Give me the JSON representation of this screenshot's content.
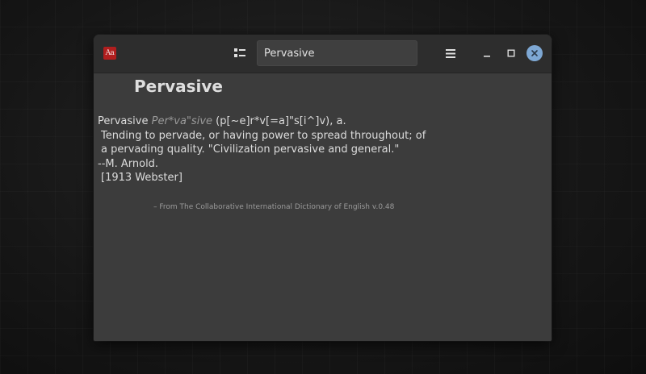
{
  "app": {
    "icon": "dictionary-app-icon",
    "icon_text": "Aa"
  },
  "header": {
    "view_icon": "view-toggle-icon",
    "search": {
      "value": "Pervasive",
      "placeholder": ""
    },
    "menu_icon": "hamburger-menu-icon",
    "minimize_icon": "minimize-icon",
    "maximize_icon": "maximize-icon",
    "close_icon": "close-icon"
  },
  "entry": {
    "headword": "Pervasive",
    "word": "Pervasive",
    "pronunciation": "Per*va\"sive",
    "phonetic": "(p[~e]r*v[=a]\"s[i^]v), a.",
    "definition_line1": "Tending to pervade, or having power to spread throughout; of",
    "definition_line2": "a pervading quality. \"Civilization pervasive and general.\"",
    "attribution": "--M. Arnold.",
    "citation": "[1913 Webster]",
    "source": "– From The Collaborative International Dictionary of English v.0.48"
  },
  "colors": {
    "titlebar": "#2d2d2d",
    "content": "#3c3c3c",
    "close_button": "#7ea8d4",
    "app_icon": "#b01e1e"
  }
}
